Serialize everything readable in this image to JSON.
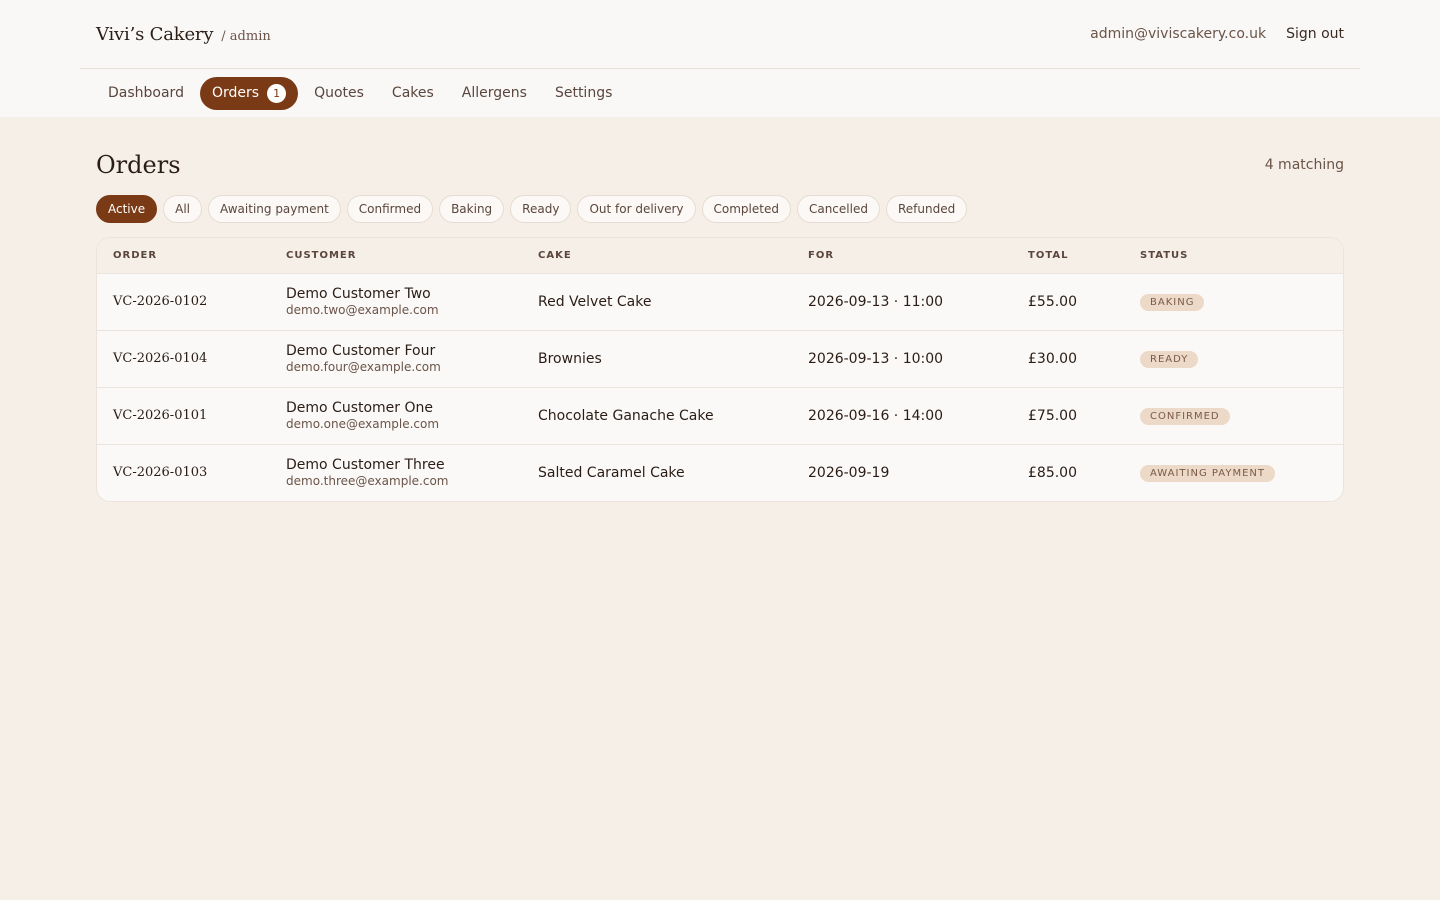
{
  "header": {
    "brand": "Vivi’s Cakery",
    "role": "/ admin",
    "email": "admin@viviscakery.co.uk",
    "signout": "Sign out"
  },
  "nav": [
    {
      "label": "Dashboard",
      "active": false
    },
    {
      "label": "Orders",
      "active": true,
      "badge": "1"
    },
    {
      "label": "Quotes",
      "active": false
    },
    {
      "label": "Cakes",
      "active": false
    },
    {
      "label": "Allergens",
      "active": false
    },
    {
      "label": "Settings",
      "active": false
    }
  ],
  "page": {
    "title": "Orders",
    "match_count": "4 matching"
  },
  "filters": [
    {
      "label": "Active",
      "active": true
    },
    {
      "label": "All"
    },
    {
      "label": "Awaiting payment"
    },
    {
      "label": "Confirmed"
    },
    {
      "label": "Baking"
    },
    {
      "label": "Ready"
    },
    {
      "label": "Out for delivery"
    },
    {
      "label": "Completed"
    },
    {
      "label": "Cancelled"
    },
    {
      "label": "Refunded"
    }
  ],
  "table": {
    "columns": [
      "ORDER",
      "CUSTOMER",
      "CAKE",
      "FOR",
      "TOTAL",
      "STATUS"
    ],
    "rows": [
      {
        "order": "VC-2026-0102",
        "name": "Demo Customer Two",
        "email": "demo.two@example.com",
        "cake": "Red Velvet Cake",
        "for": "2026-09-13 · 11:00",
        "total": "£55.00",
        "status": "BAKING"
      },
      {
        "order": "VC-2026-0104",
        "name": "Demo Customer Four",
        "email": "demo.four@example.com",
        "cake": "Brownies",
        "for": "2026-09-13 · 10:00",
        "total": "£30.00",
        "status": "READY"
      },
      {
        "order": "VC-2026-0101",
        "name": "Demo Customer One",
        "email": "demo.one@example.com",
        "cake": "Chocolate Ganache Cake",
        "for": "2026-09-16 · 14:00",
        "total": "£75.00",
        "status": "CONFIRMED"
      },
      {
        "order": "VC-2026-0103",
        "name": "Demo Customer Three",
        "email": "demo.three@example.com",
        "cake": "Salted Caramel Cake",
        "for": "2026-09-19",
        "total": "£85.00",
        "status": "AWAITING PAYMENT"
      }
    ]
  }
}
